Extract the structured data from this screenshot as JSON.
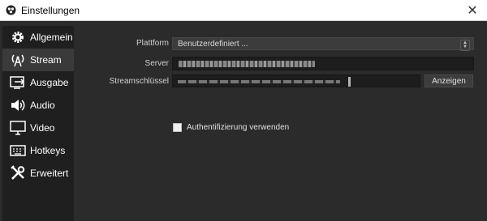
{
  "window": {
    "title": "Einstellungen"
  },
  "sidebar": {
    "items": [
      {
        "label": "Allgemein",
        "icon": "gear-icon"
      },
      {
        "label": "Stream",
        "icon": "broadcast-icon"
      },
      {
        "label": "Ausgabe",
        "icon": "output-icon"
      },
      {
        "label": "Audio",
        "icon": "speaker-icon"
      },
      {
        "label": "Video",
        "icon": "monitor-icon"
      },
      {
        "label": "Hotkeys",
        "icon": "keyboard-icon"
      },
      {
        "label": "Erweitert",
        "icon": "tools-icon"
      }
    ],
    "active_index": 1
  },
  "stream": {
    "platform_label": "Plattform",
    "platform_value": "Benutzerdefiniert ...",
    "server_label": "Server",
    "key_label": "Streamschlüssel",
    "show_button": "Anzeigen",
    "auth_label": "Authentifizierung verwenden"
  },
  "colors": {
    "background": "#2b2b2b",
    "sidebar": "#1f1f1f",
    "active_item": "#3a3a3a",
    "field": "#1d1d1d"
  }
}
